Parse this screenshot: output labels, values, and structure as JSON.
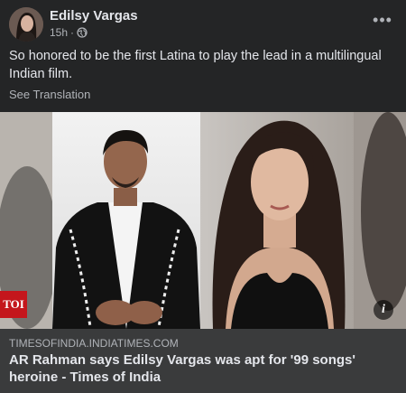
{
  "post": {
    "author": "Edilsy Vargas",
    "time": "15h",
    "time_separator": "·",
    "text": "So honored to be the first Latina to play the lead in a multilingual Indian film.",
    "see_translation": "See Translation",
    "more_options": "•••"
  },
  "link_preview": {
    "domain": "TIMESOFINDIA.INDIATIMES.COM",
    "title": "AR Rahman says Edilsy Vargas was apt for '99 songs' heroine - Times of India",
    "logo_text": "TOI",
    "info_label": "i"
  },
  "colors": {
    "card_bg": "#242526",
    "footer_bg": "#3a3b3c",
    "primary_text": "#e4e6eb",
    "secondary_text": "#b0b3b8",
    "toi_red": "#c4161c"
  },
  "icons": {
    "privacy": "globe-icon",
    "more": "more-horizontal-icon",
    "info": "info-icon"
  }
}
